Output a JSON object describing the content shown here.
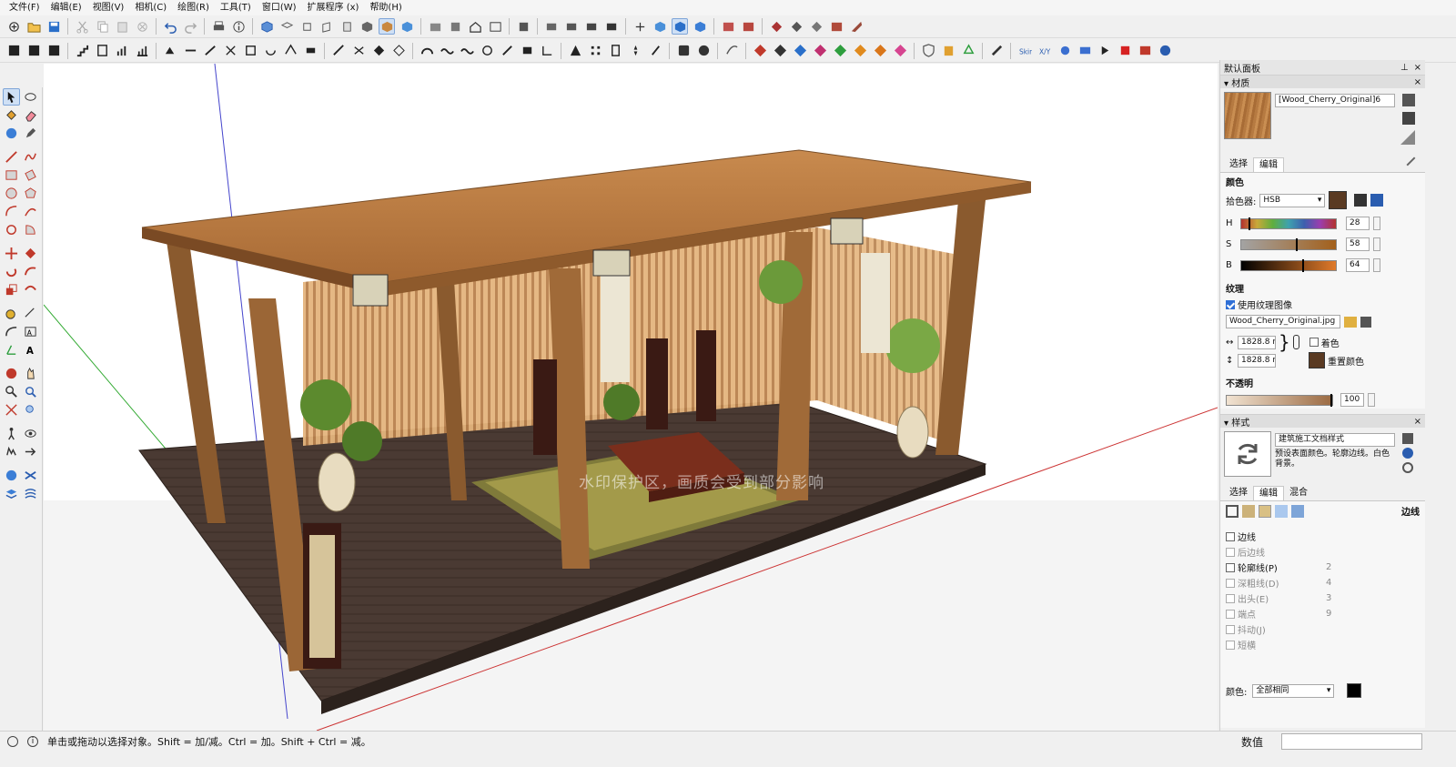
{
  "menu": [
    "文件(F)",
    "编辑(E)",
    "视图(V)",
    "相机(C)",
    "绘图(R)",
    "工具(T)",
    "窗口(W)",
    "扩展程序 (x)",
    "帮助(H)"
  ],
  "viewport": {
    "watermark": "水印保护区，画质会受到部分影响"
  },
  "tray": {
    "title": "默认面板",
    "materials": {
      "header": "材质",
      "material_name": "[Wood_Cherry_Original]6",
      "tabs": [
        "选择",
        "编辑"
      ],
      "color_label": "颜色",
      "picker_label": "拾色器:",
      "picker_value": "HSB",
      "h_label": "H",
      "h_value": "28",
      "s_label": "S",
      "s_value": "58",
      "b_label": "B",
      "b_value": "64",
      "texture_label": "纹理",
      "use_texture": "使用纹理图像",
      "texture_file": "Wood_Cherry_Original.jpg",
      "width_value": "1828.8 mr",
      "height_value": "1828.8 mr",
      "colorize": "着色",
      "reset_color": "重置颜色",
      "opacity_label": "不透明",
      "opacity_value": "100",
      "swatch_color": "#5a3a22"
    },
    "styles": {
      "header": "样式",
      "style_name": "建筑施工文档样式",
      "style_desc": "预设表面颜色。轮廓边线。白色背景。",
      "tabs": [
        "选择",
        "编辑",
        "混合"
      ],
      "edge_label": "边线",
      "edges": [
        {
          "label": "边线",
          "value": "",
          "enabled": true
        },
        {
          "label": "后边线",
          "value": "",
          "enabled": false
        },
        {
          "label": "轮廓线(P)",
          "value": "2",
          "enabled": true
        },
        {
          "label": "深粗线(D)",
          "value": "4",
          "enabled": false
        },
        {
          "label": "出头(E)",
          "value": "3",
          "enabled": false
        },
        {
          "label": "端点",
          "value": "9",
          "enabled": false
        },
        {
          "label": "抖动(J)",
          "value": "",
          "enabled": false
        },
        {
          "label": "短横",
          "value": "",
          "enabled": false
        }
      ],
      "color_label": "颜色:",
      "color_value": "全部相同"
    }
  },
  "status": {
    "text": "单击或拖动以选择对象。Shift = 加/减。Ctrl = 加。Shift + Ctrl = 减。",
    "measure_label": "数值"
  }
}
